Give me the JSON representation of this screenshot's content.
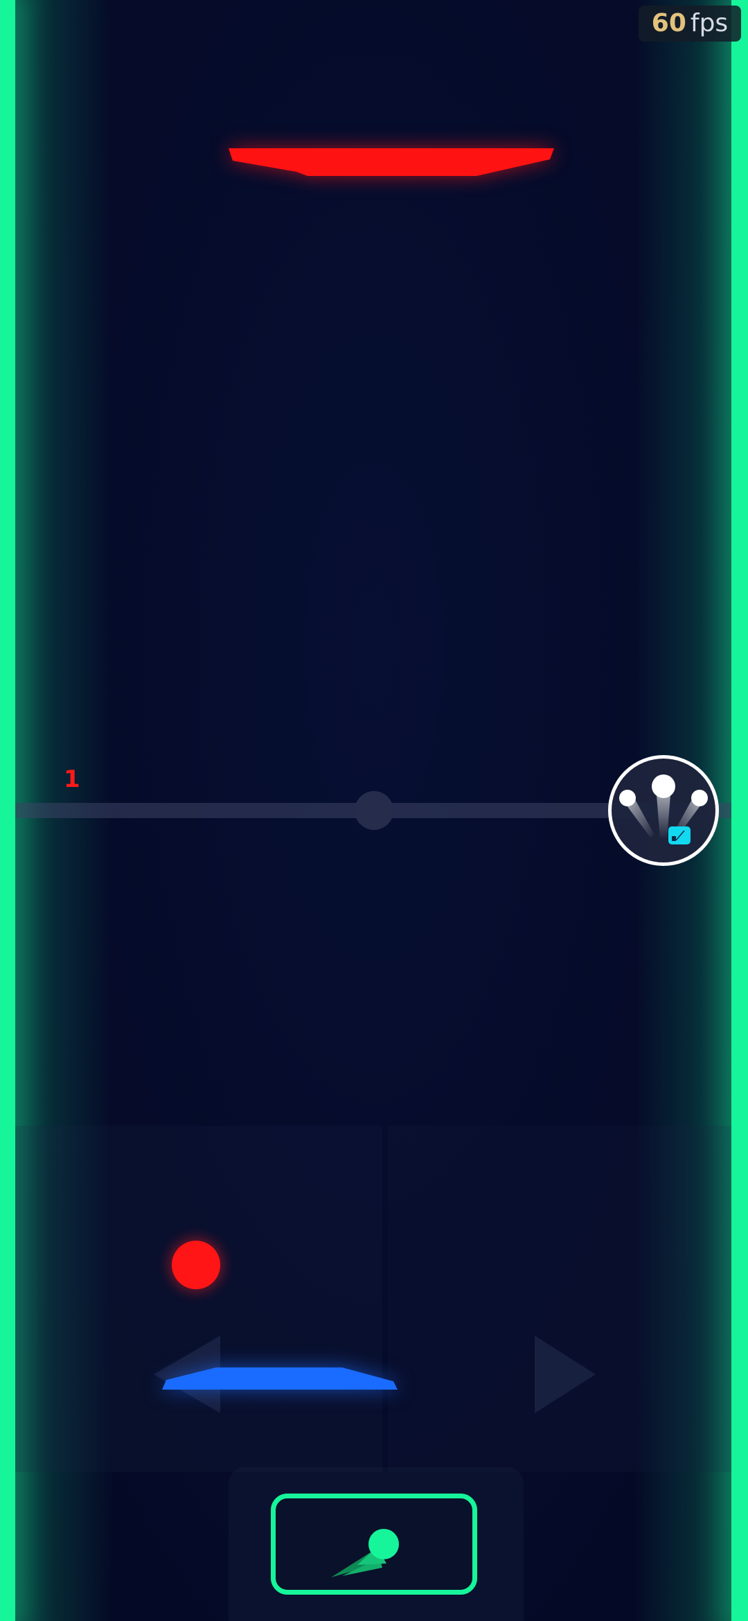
{
  "hud": {
    "fps_value": "60",
    "fps_unit": "fps"
  },
  "score": {
    "opponent": "1"
  },
  "colors": {
    "wall": "#16f59a",
    "opponent_paddle": "#ff1212",
    "player_paddle": "#1a6bff",
    "ball": "#ff1515",
    "powerup_badge": "#12d8f0"
  },
  "icons": {
    "powerup": "multi-ball-icon",
    "shoot": "comet-ball-icon",
    "move_left": "triangle-left-icon",
    "move_right": "triangle-right-icon"
  }
}
